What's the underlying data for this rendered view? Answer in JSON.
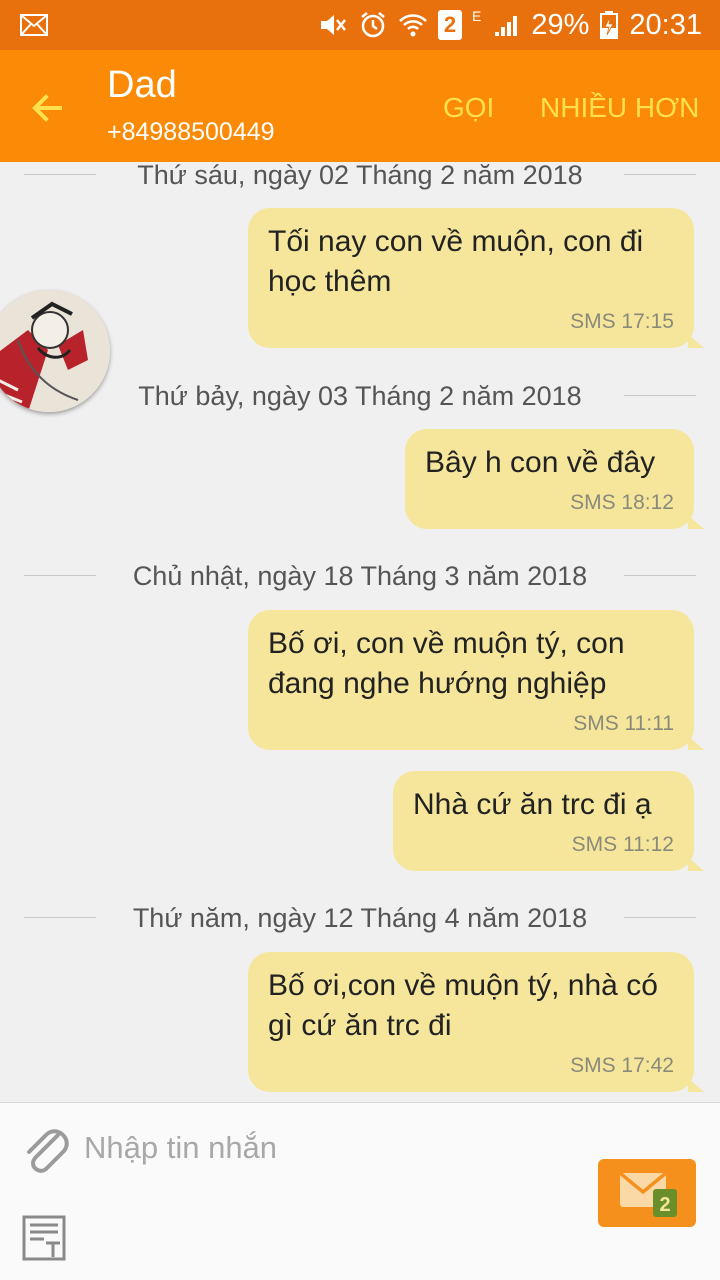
{
  "status_bar": {
    "sim_number": "2",
    "network_type": "E",
    "battery": "29%",
    "time": "20:31",
    "icons": [
      "mail-icon",
      "mute-icon",
      "alarm-icon",
      "wifi-icon",
      "sim-icon",
      "signal-icon",
      "battery-charging-icon"
    ]
  },
  "header": {
    "contact_name": "Dad",
    "contact_phone": "+84988500449",
    "call_label": "GỌI",
    "more_label": "NHIỀU HƠN",
    "back_icon": "arrow-back-icon"
  },
  "conversation": {
    "days": [
      {
        "date": "Thứ sáu, ngày 02 Tháng 2 năm 2018",
        "messages": [
          {
            "text": "Tối nay con về muộn, con đi học thêm",
            "meta": "SMS 17:15"
          }
        ]
      },
      {
        "date": "Thứ bảy, ngày 03 Tháng 2 năm 2018",
        "messages": [
          {
            "text": "Bây h con về đây",
            "meta": "SMS 18:12"
          }
        ]
      },
      {
        "date": "Chủ nhật, ngày 18 Tháng 3 năm 2018",
        "messages": [
          {
            "text": "Bố ơi, con về muộn tý, con đang nghe hướng nghiệp",
            "meta": "SMS 11:11"
          },
          {
            "text": "Nhà cứ ăn trc đi ạ",
            "meta": "SMS 11:12"
          }
        ]
      },
      {
        "date": "Thứ năm, ngày 12 Tháng 4 năm 2018",
        "messages": [
          {
            "text": "Bố ơi,con về muộn tý, nhà có gì cứ ăn trc đi",
            "meta": "SMS 17:42"
          }
        ]
      }
    ]
  },
  "composer": {
    "placeholder": "Nhập tin nhắn",
    "send_badge": "2",
    "icons": [
      "paperclip-icon",
      "send-sms-icon",
      "text-template-icon"
    ]
  },
  "colors": {
    "status_bar": "#e8710d",
    "app_bar": "#fb8a06",
    "action_text": "#ffe14d",
    "bubble": "#f6e69c",
    "send_button": "#f5901c",
    "background": "#f0f0f0"
  }
}
